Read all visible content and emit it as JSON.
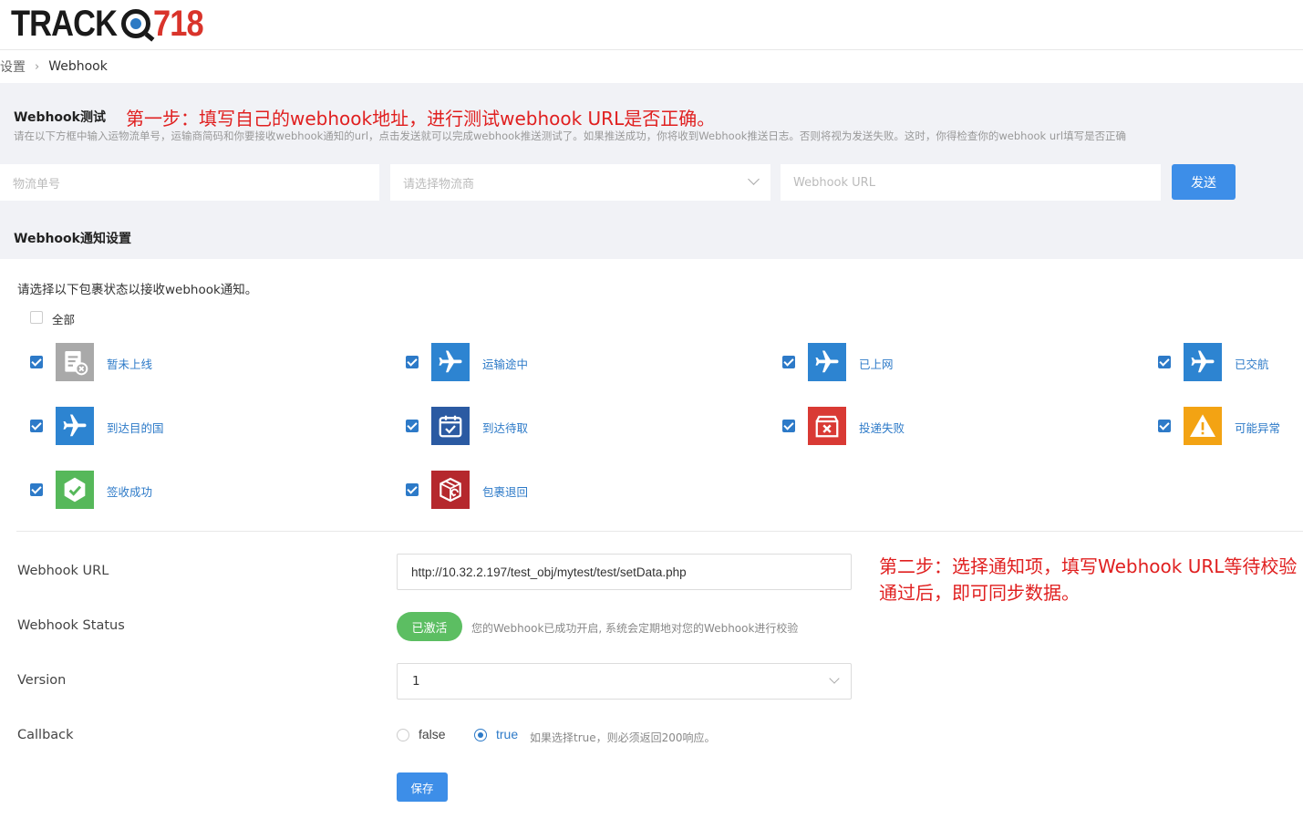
{
  "header": {
    "logo_text_a": "TRACK",
    "logo_text_b": "718"
  },
  "breadcrumb": {
    "parent": "设置",
    "separator": "›",
    "current": "Webhook"
  },
  "test_section": {
    "title": "Webhook测试",
    "annotation": "第一步：填写自己的webhook地址，进行测试webhook URL是否正确。",
    "description": "请在以下方框中输入运物流单号，运输商简码和你要接收webhook通知的url，点击发送就可以完成webhook推送测试了。如果推送成功，你将收到Webhook推送日志。否则将视为发送失败。这时，你得检查你的webhook url填写是否正确",
    "tracking_placeholder": "物流单号",
    "carrier_placeholder": "请选择物流商",
    "url_placeholder": "Webhook URL",
    "send_label": "发送"
  },
  "notify_section": {
    "title": "Webhook通知设置",
    "hint": "请选择以下包裹状态以接收webhook通知。",
    "all_label": "全部",
    "all_checked": false,
    "statuses": [
      {
        "label": "暂未上线",
        "icon": "pending-doc-icon",
        "color": "#a9a9a9",
        "checked": true
      },
      {
        "label": "运输途中",
        "icon": "airplane-icon",
        "color": "#2d84d1",
        "checked": true
      },
      {
        "label": "已上网",
        "icon": "airplane-icon",
        "color": "#2d84d1",
        "checked": true
      },
      {
        "label": "已交航",
        "icon": "airplane-icon",
        "color": "#2d84d1",
        "checked": true
      },
      {
        "label": "到达目的国",
        "icon": "airplane-icon",
        "color": "#2d84d1",
        "checked": true
      },
      {
        "label": "到达待取",
        "icon": "calendar-check-icon",
        "color": "#2b5aa2",
        "checked": true
      },
      {
        "label": "投递失败",
        "icon": "failed-box-icon",
        "color": "#d93a34",
        "checked": true
      },
      {
        "label": "可能异常",
        "icon": "warning-icon",
        "color": "#f3a313",
        "checked": true
      },
      {
        "label": "签收成功",
        "icon": "shield-check-icon",
        "color": "#56b85a",
        "checked": true
      },
      {
        "label": "包裹退回",
        "icon": "return-box-icon",
        "color": "#b5282d",
        "checked": true
      }
    ]
  },
  "form": {
    "url_label": "Webhook URL",
    "url_value": "http://10.32.2.197/test_obj/mytest/test/setData.php",
    "annotation": "第二步：选择通知项，填写Webhook URL等待校验通过后，即可同步数据。",
    "status_label": "Webhook Status",
    "status_value": "已激活",
    "status_note": "您的Webhook已成功开启, 系统会定期地对您的Webhook进行校验",
    "version_label": "Version",
    "version_value": "1",
    "callback_label": "Callback",
    "callback_false": "false",
    "callback_true": "true",
    "callback_selected": "true",
    "callback_note": "如果选择true，则必须返回200响应。",
    "save_label": "保存"
  },
  "colors": {
    "accent": "#3d8ee8",
    "annotation": "#e02020",
    "active": "#5cbe62"
  }
}
